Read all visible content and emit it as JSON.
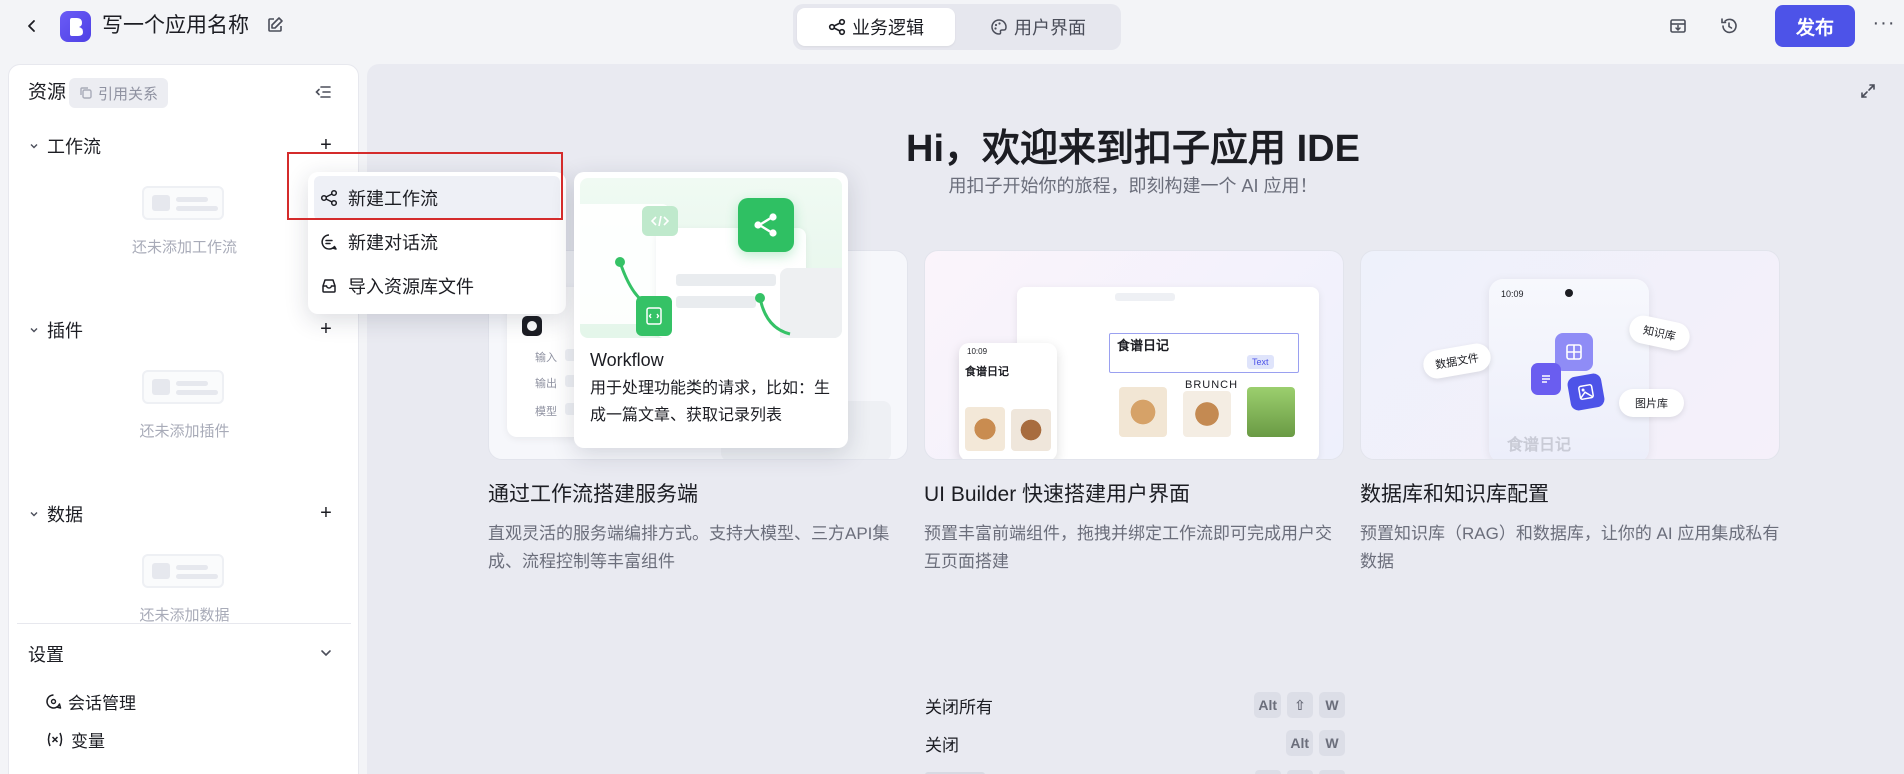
{
  "app": {
    "name": "写一个应用名称"
  },
  "mode_tabs": [
    {
      "label": "业务逻辑",
      "active": true
    },
    {
      "label": "用户界面",
      "active": false
    }
  ],
  "toolbar": {
    "publish_label": "发布",
    "more_label": "···"
  },
  "sidebar": {
    "title": "资源",
    "ref_chip": "引用关系",
    "sections": [
      {
        "label": "工作流",
        "empty_text": "还未添加工作流"
      },
      {
        "label": "插件",
        "empty_text": "还未添加插件"
      },
      {
        "label": "数据",
        "empty_text": "还未添加数据"
      }
    ],
    "settings": {
      "label": "设置",
      "items": [
        {
          "label": "会话管理",
          "icon": "chat-settings-icon"
        },
        {
          "label": "变量",
          "icon": "variable-icon"
        }
      ]
    }
  },
  "dropdown": {
    "items": [
      {
        "label": "新建工作流",
        "icon": "workflow-icon"
      },
      {
        "label": "新建对话流",
        "icon": "chatflow-icon"
      },
      {
        "label": "导入资源库文件",
        "icon": "library-import-icon"
      }
    ]
  },
  "tooltip": {
    "title": "Workflow",
    "desc": "用于处理功能类的请求，比如：生成一篇文章、获取记录列表"
  },
  "main": {
    "hero_title": "Hi，欢迎来到扣子应用 IDE",
    "hero_sub": "用扣子开始你的旅程，即刻构建一个 AI 应用！",
    "features": [
      {
        "title": "通过工作流搭建服务端",
        "desc": "直观灵活的服务端编排方式。支持大模型、三方API集成、流程控制等丰富组件"
      },
      {
        "title": "UI Builder 快速搭建用户界面",
        "desc": "预置丰富前端组件，拖拽并绑定工作流即可完成用户交互页面搭建"
      },
      {
        "title": "数据库和知识库配置",
        "desc": "预置知识库（RAG）和数据库，让你的 AI 应用集成私有数据"
      }
    ],
    "feature_art": {
      "workflow": {
        "input": "输入",
        "output": "输出",
        "model": "模型"
      },
      "uibuilder": {
        "card_title": "食谱日记",
        "brunch": "BRUNCH",
        "text_chip": "Text",
        "time": "10:09"
      },
      "database": {
        "time": "10:09",
        "tag1": "数据文件",
        "tag2": "知识库",
        "tag3": "图片库",
        "card_title": "食谱日记"
      }
    },
    "shortcuts": [
      {
        "label": "关闭所有",
        "keys": [
          "Alt",
          "⇧",
          "W"
        ]
      },
      {
        "label": "关闭",
        "keys": [
          "Alt",
          "W"
        ]
      }
    ]
  },
  "colors": {
    "accent": "#4d53e8",
    "workflow_green": "#35c266",
    "highlight_red": "#d42b2b"
  }
}
